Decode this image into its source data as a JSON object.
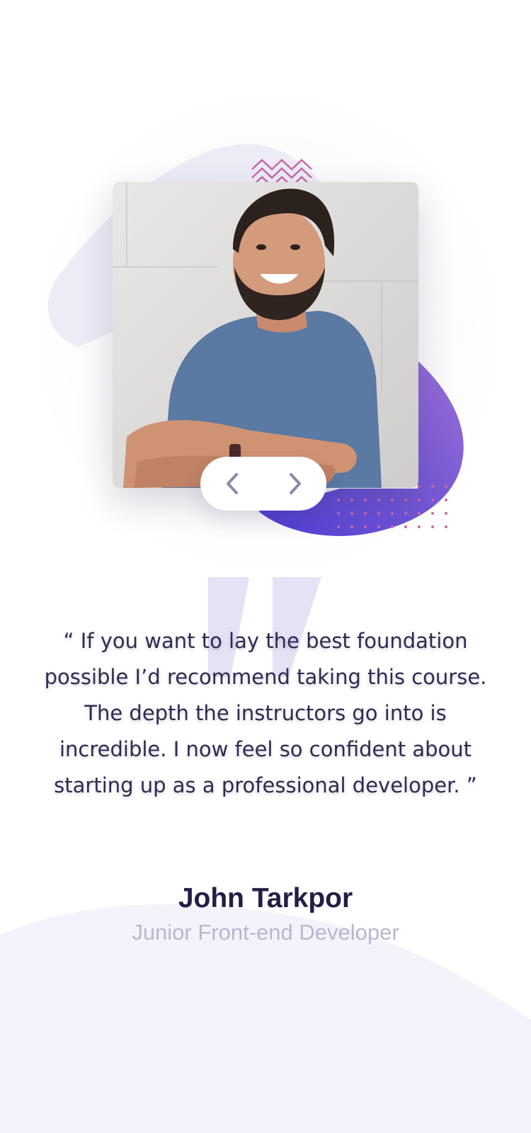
{
  "testimonial": {
    "quote": "“ If you want to lay the best foundation possible I’d recommend taking this course. The depth the instructors go into is incredible. I now feel so confident about starting up as a professional developer. ”",
    "author_name": "John Tarkpor",
    "author_role": "Junior Front-end Developer"
  },
  "navigation": {
    "prev_icon": "chevron-left-icon",
    "next_icon": "chevron-right-icon"
  },
  "colors": {
    "background": "#ffffff",
    "bottom_wave": "#f2f3fb",
    "pale_blob": "#ececf7",
    "purple_blob_start": "#4f3fd4",
    "purple_blob_end": "#9a6fd6",
    "accent_pink": "#c86aa8",
    "quote_text": "#2d2d4f",
    "author_name": "#202046",
    "author_role": "#b7b7d0",
    "chevron": "#8a8aa8"
  }
}
